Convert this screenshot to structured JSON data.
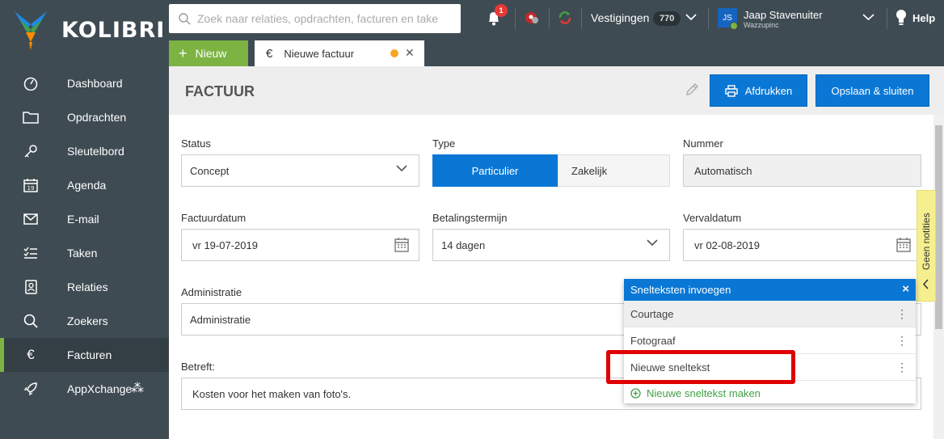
{
  "app": {
    "name": "KOLIBRI"
  },
  "sidebar": {
    "items": [
      {
        "label": "Dashboard",
        "icon": "dashboard-icon"
      },
      {
        "label": "Opdrachten",
        "icon": "folder-icon"
      },
      {
        "label": "Sleutelbord",
        "icon": "key-icon"
      },
      {
        "label": "Agenda",
        "icon": "calendar-icon"
      },
      {
        "label": "E-mail",
        "icon": "mail-icon"
      },
      {
        "label": "Taken",
        "icon": "tasks-icon"
      },
      {
        "label": "Relaties",
        "icon": "contacts-icon"
      },
      {
        "label": "Zoekers",
        "icon": "search-icon"
      },
      {
        "label": "Facturen",
        "icon": "euro-icon",
        "active": true
      },
      {
        "label": "AppXchange",
        "icon": "rocket-icon"
      }
    ]
  },
  "topbar": {
    "search_placeholder": "Zoek naar relaties, opdrachten, facturen en take",
    "notification_count": "1",
    "vestigingen_label": "Vestigingen",
    "vestigingen_count": "770",
    "avatar_initials": "JS",
    "user_name": "Jaap Stavenuiter",
    "user_company": "Wazzupinc",
    "help_label": "Help"
  },
  "tabs": {
    "new_label": "Nieuw",
    "active_tab": "Nieuwe factuur"
  },
  "header": {
    "title": "FACTUUR",
    "print_label": "Afdrukken",
    "save_label": "Opslaan & sluiten"
  },
  "form": {
    "status": {
      "label": "Status",
      "value": "Concept"
    },
    "type": {
      "label": "Type",
      "options": [
        "Particulier",
        "Zakelijk"
      ],
      "selected": "Particulier"
    },
    "nummer": {
      "label": "Nummer",
      "value": "Automatisch"
    },
    "factuurdatum": {
      "label": "Factuurdatum",
      "value": "vr 19-07-2019"
    },
    "betalingstermijn": {
      "label": "Betalingstermijn",
      "value": "14 dagen"
    },
    "vervaldatum": {
      "label": "Vervaldatum",
      "value": "vr 02-08-2019"
    },
    "administratie": {
      "label": "Administratie",
      "value": "Administratie"
    },
    "betreft": {
      "label": "Betreft:",
      "value": "Kosten voor het maken van foto's."
    }
  },
  "notities": {
    "label": "Geen notities"
  },
  "popup": {
    "title": "Snelteksten invoegen",
    "items": [
      "Courtage",
      "Fotograaf",
      "Nieuwe sneltekst"
    ],
    "new_label": "Nieuwe sneltekst maken"
  },
  "colors": {
    "accent": "#0a77d5",
    "green": "#7cb342",
    "sidebar": "#3f4b53",
    "highlight": "#e00000"
  }
}
